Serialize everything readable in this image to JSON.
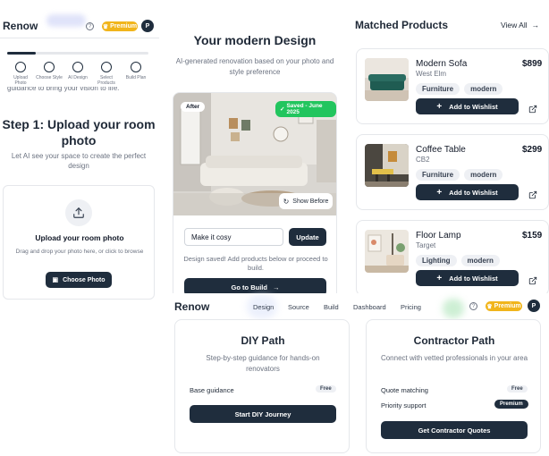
{
  "left": {
    "logo": "Renow",
    "premium_label": "Premium",
    "avatar_initial": "P",
    "help_glyph": "?",
    "steps": [
      {
        "label": "Upload Photo"
      },
      {
        "label": "Choose Style"
      },
      {
        "label": "AI Design"
      },
      {
        "label": "Select Products"
      },
      {
        "label": "Build Plan"
      }
    ],
    "cutoff_text": "guidance to bring your vision to life.",
    "step_title": "Step 1: Upload your room photo",
    "step_subtitle": "Let AI see your space to create the perfect design",
    "upload_title": "Upload your room photo",
    "upload_hint": "Drag and drop your photo here, or click to browse",
    "choose_button": "Choose Photo"
  },
  "design": {
    "title": "Your modern Design",
    "subtitle": "AI-generated renovation based on your photo and style preference",
    "after_badge": "After",
    "saved_badge": "Saved - June 2025",
    "show_before": "Show Before",
    "prompt_value": "Make it cosy",
    "update_button": "Update",
    "saved_message": "Design saved! Add products below or proceed to build.",
    "go_build_button": "Go to Build"
  },
  "products": {
    "heading": "Matched Products",
    "view_all": "View All",
    "add_label": "Add to Wishlist",
    "items": [
      {
        "name": "Modern Sofa",
        "brand": "West Elm",
        "price": "$899",
        "tags": [
          "Furniture",
          "modern"
        ]
      },
      {
        "name": "Coffee Table",
        "brand": "CB2",
        "price": "$299",
        "tags": [
          "Furniture",
          "modern"
        ]
      },
      {
        "name": "Floor Lamp",
        "brand": "Target",
        "price": "$159",
        "tags": [
          "Lighting",
          "modern"
        ]
      }
    ]
  },
  "nav": {
    "logo": "Renow",
    "links": [
      "Design",
      "Source",
      "Build",
      "Dashboard",
      "Pricing"
    ],
    "active": "Design",
    "premium_label": "Premium",
    "avatar_initial": "P",
    "help_glyph": "?"
  },
  "diy": {
    "title": "DIY Path",
    "subtitle": "Step-by-step guidance for hands-on renovators",
    "feature": "Base guidance",
    "feature_badge": "Free",
    "button": "Start DIY Journey"
  },
  "contractor": {
    "title": "Contractor Path",
    "subtitle": "Connect with vetted professionals in your area",
    "features": [
      {
        "label": "Quote matching",
        "badge": "Free"
      },
      {
        "label": "Priority support",
        "badge": "Premium"
      }
    ],
    "button": "Get Contractor Quotes"
  },
  "colors": {
    "primary_dark": "#1f2d3d",
    "premium_gold": "#f1b51c",
    "saved_green": "#22c55e",
    "chip_bg": "#eef0f4"
  }
}
